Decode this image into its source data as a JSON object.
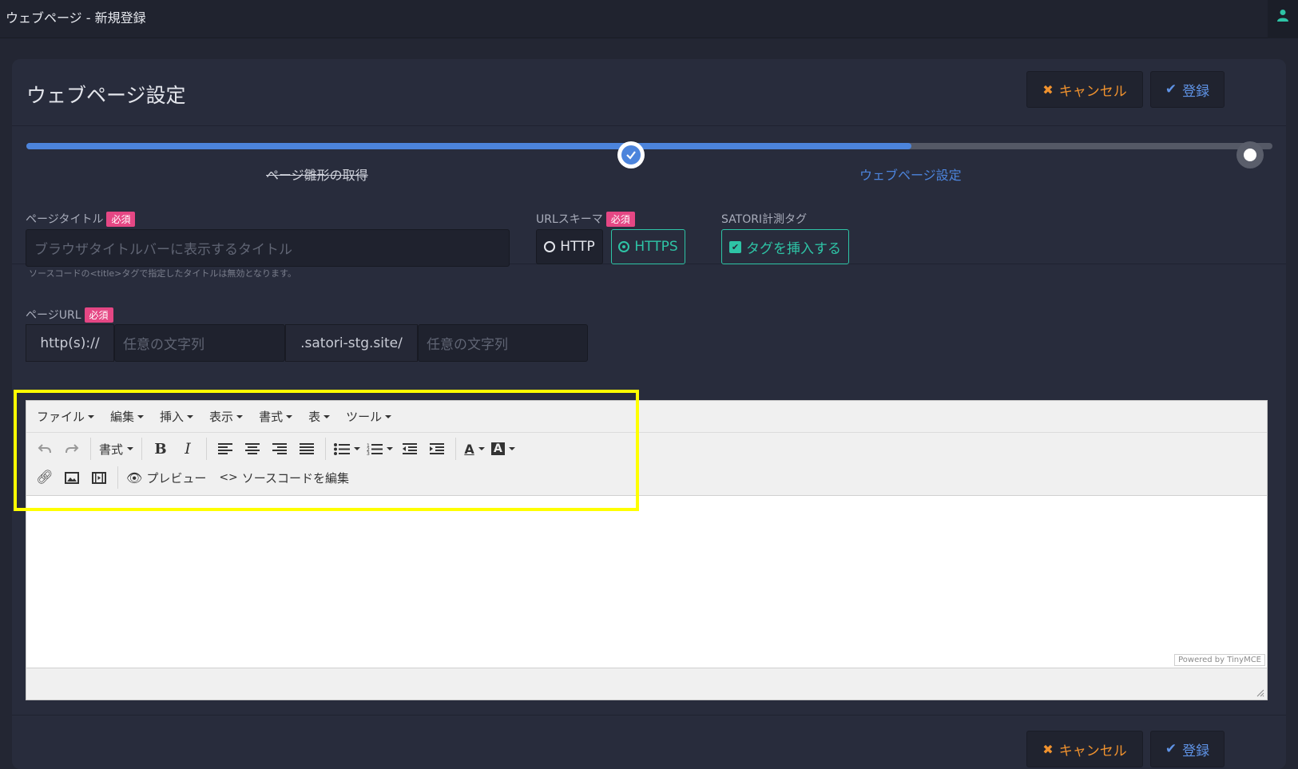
{
  "window": {
    "title": "ウェブページ - 新規登録"
  },
  "header": {
    "title": "ウェブページ設定",
    "cancel_label": "キャンセル",
    "submit_label": "登録"
  },
  "steps": {
    "step1": "ページ雛形の取得",
    "step2": "ウェブページ設定",
    "progress": 0.71
  },
  "form": {
    "page_title": {
      "label": "ページタイトル",
      "required": "必須",
      "placeholder": "ブラウザタイトルバーに表示するタイトル",
      "help": "ソースコードの<title>タグで指定したタイトルは無効となります。"
    },
    "url_scheme": {
      "label": "URLスキーマ",
      "required": "必須",
      "options": [
        "HTTP",
        "HTTPS"
      ],
      "selected": "HTTPS"
    },
    "tag": {
      "label": "SATORI計測タグ",
      "checkbox_label": "タグを挿入する",
      "checked": true
    },
    "page_url": {
      "label": "ページURL",
      "required": "必須",
      "prefix": "http(s)://",
      "placeholder1": "任意の文字列",
      "domain": ".satori-stg.site/",
      "placeholder2": "任意の文字列"
    }
  },
  "editor": {
    "menu": [
      "ファイル",
      "編集",
      "挿入",
      "表示",
      "書式",
      "表",
      "ツール"
    ],
    "format_label": "書式",
    "preview_label": "プレビュー",
    "source_label": "ソースコードを編集",
    "powered": "Powered by TinyMCE"
  },
  "footer": {
    "cancel_label": "キャンセル",
    "submit_label": "登録"
  },
  "colors": {
    "accent": "#4c84dc",
    "cancel": "#f0922e",
    "teal": "#2ec4a6",
    "required": "#e54784",
    "highlight": "#ffff00"
  }
}
